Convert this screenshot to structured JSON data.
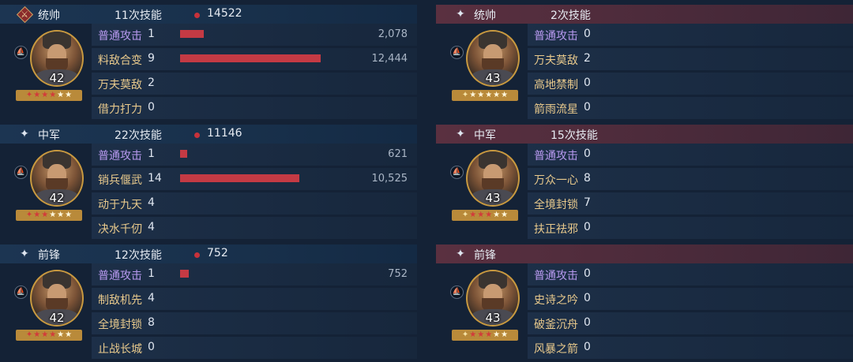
{
  "teams": [
    {
      "side": "left",
      "slots": [
        {
          "role": "统帅",
          "role_icon": "commander-diamond-icon",
          "skill_count": "11次技能",
          "damage_total": "14522",
          "level": "42",
          "stars": [
            "red",
            "red",
            "red",
            "red",
            "white",
            "white"
          ],
          "skills": [
            {
              "name": "普通攻击",
              "count": "1",
              "damage": "2,078",
              "damage_value": 2078,
              "basic": true
            },
            {
              "name": "料敌合变",
              "count": "9",
              "damage": "12,444",
              "damage_value": 12444,
              "basic": false
            },
            {
              "name": "万夫莫敌",
              "count": "2",
              "damage": "",
              "damage_value": 0,
              "basic": false
            },
            {
              "name": "借力打力",
              "count": "0",
              "damage": "",
              "damage_value": 0,
              "basic": false
            }
          ]
        },
        {
          "role": "中军",
          "role_icon": "sparkle-icon",
          "skill_count": "22次技能",
          "damage_total": "11146",
          "level": "42",
          "stars": [
            "red",
            "red",
            "red",
            "white",
            "white",
            "white"
          ],
          "skills": [
            {
              "name": "普通攻击",
              "count": "1",
              "damage": "621",
              "damage_value": 621,
              "basic": true
            },
            {
              "name": "销兵偃武",
              "count": "14",
              "damage": "10,525",
              "damage_value": 10525,
              "basic": false
            },
            {
              "name": "动于九天",
              "count": "4",
              "damage": "",
              "damage_value": 0,
              "basic": false
            },
            {
              "name": "决水千仞",
              "count": "4",
              "damage": "",
              "damage_value": 0,
              "basic": false
            }
          ]
        },
        {
          "role": "前锋",
          "role_icon": "sparkle-icon",
          "skill_count": "12次技能",
          "damage_total": "752",
          "level": "42",
          "stars": [
            "red",
            "red",
            "red",
            "red",
            "white",
            "white"
          ],
          "skills": [
            {
              "name": "普通攻击",
              "count": "1",
              "damage": "752",
              "damage_value": 752,
              "basic": true
            },
            {
              "name": "制敌机先",
              "count": "4",
              "damage": "",
              "damage_value": 0,
              "basic": false
            },
            {
              "name": "全境封锁",
              "count": "8",
              "damage": "",
              "damage_value": 0,
              "basic": false
            },
            {
              "name": "止战长城",
              "count": "0",
              "damage": "",
              "damage_value": 0,
              "basic": false
            }
          ]
        }
      ]
    },
    {
      "side": "right",
      "slots": [
        {
          "role": "统帅",
          "role_icon": "sparkle-icon",
          "skill_count": "2次技能",
          "damage_total": "",
          "level": "43",
          "stars": [
            "gold",
            "white",
            "white",
            "white",
            "white",
            "white"
          ],
          "skills": [
            {
              "name": "普通攻击",
              "count": "0",
              "damage": "",
              "damage_value": 0,
              "basic": true
            },
            {
              "name": "万夫莫敌",
              "count": "2",
              "damage": "",
              "damage_value": 0,
              "basic": false
            },
            {
              "name": "高地禁制",
              "count": "0",
              "damage": "",
              "damage_value": 0,
              "basic": false
            },
            {
              "name": "箭雨流星",
              "count": "0",
              "damage": "",
              "damage_value": 0,
              "basic": false
            }
          ]
        },
        {
          "role": "中军",
          "role_icon": "sparkle-icon",
          "skill_count": "15次技能",
          "damage_total": "",
          "level": "43",
          "stars": [
            "gold",
            "red",
            "red",
            "red",
            "white",
            "white"
          ],
          "skills": [
            {
              "name": "普通攻击",
              "count": "0",
              "damage": "",
              "damage_value": 0,
              "basic": true
            },
            {
              "name": "万众一心",
              "count": "8",
              "damage": "",
              "damage_value": 0,
              "basic": false
            },
            {
              "name": "全境封锁",
              "count": "7",
              "damage": "",
              "damage_value": 0,
              "basic": false
            },
            {
              "name": "扶正祛邪",
              "count": "0",
              "damage": "",
              "damage_value": 0,
              "basic": false
            }
          ]
        },
        {
          "role": "前锋",
          "role_icon": "sparkle-icon",
          "skill_count": "",
          "damage_total": "",
          "level": "43",
          "stars": [
            "gold",
            "red",
            "red",
            "red",
            "white",
            "white"
          ],
          "skills": [
            {
              "name": "普通攻击",
              "count": "0",
              "damage": "",
              "damage_value": 0,
              "basic": true
            },
            {
              "name": "史诗之吟",
              "count": "0",
              "damage": "",
              "damage_value": 0,
              "basic": false
            },
            {
              "name": "破釜沉舟",
              "count": "0",
              "damage": "",
              "damage_value": 0,
              "basic": false
            },
            {
              "name": "风暴之箭",
              "count": "0",
              "damage": "",
              "damage_value": 0,
              "basic": false
            }
          ]
        }
      ]
    }
  ],
  "max_damage_value": 12444
}
